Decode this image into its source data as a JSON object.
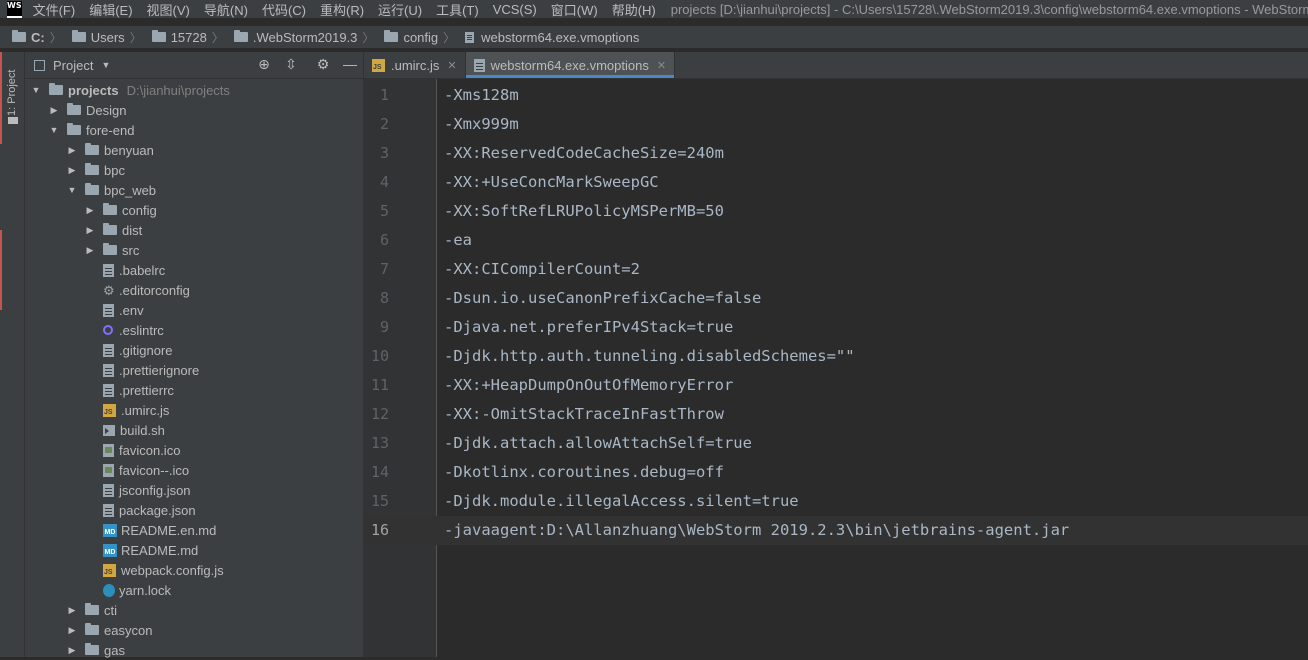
{
  "app": {
    "logo_text": "WS",
    "menus": [
      "文件(F)",
      "编辑(E)",
      "视图(V)",
      "导航(N)",
      "代码(C)",
      "重构(R)",
      "运行(U)",
      "工具(T)",
      "VCS(S)",
      "窗口(W)",
      "帮助(H)"
    ],
    "window_title": "projects [D:\\jianhui\\projects] - C:\\Users\\15728\\.WebStorm2019.3\\config\\webstorm64.exe.vmoptions - WebStorm"
  },
  "breadcrumb": [
    "C:",
    "Users",
    "15728",
    ".WebStorm2019.3",
    "config",
    "webstorm64.exe.vmoptions"
  ],
  "tool_stripe": {
    "label": "1: Project"
  },
  "project_panel": {
    "title": "Project"
  },
  "tree": [
    {
      "label": "projects",
      "path": "D:\\jianhui\\projects",
      "type": "folder",
      "arrow": "down",
      "depth": 0,
      "root": true
    },
    {
      "label": "Design",
      "type": "folder",
      "arrow": "right",
      "depth": 1
    },
    {
      "label": "fore-end",
      "type": "folder",
      "arrow": "down",
      "depth": 1
    },
    {
      "label": "benyuan",
      "type": "folder",
      "arrow": "right",
      "depth": 2
    },
    {
      "label": "bpc",
      "type": "folder",
      "arrow": "right",
      "depth": 2
    },
    {
      "label": "bpc_web",
      "type": "folder",
      "arrow": "down",
      "depth": 2
    },
    {
      "label": "config",
      "type": "folder",
      "arrow": "right",
      "depth": 3
    },
    {
      "label": "dist",
      "type": "folder",
      "arrow": "right",
      "depth": 3
    },
    {
      "label": "src",
      "type": "folder",
      "arrow": "right",
      "depth": 3
    },
    {
      "label": ".babelrc",
      "type": "generic",
      "depth": 3
    },
    {
      "label": ".editorconfig",
      "type": "gear",
      "depth": 3
    },
    {
      "label": ".env",
      "type": "generic",
      "depth": 3
    },
    {
      "label": ".eslintrc",
      "type": "ring",
      "depth": 3
    },
    {
      "label": ".gitignore",
      "type": "generic",
      "depth": 3
    },
    {
      "label": ".prettierignore",
      "type": "generic",
      "depth": 3
    },
    {
      "label": ".prettierrc",
      "type": "generic",
      "depth": 3
    },
    {
      "label": ".umirc.js",
      "type": "js",
      "depth": 3
    },
    {
      "label": "build.sh",
      "type": "sh",
      "depth": 3
    },
    {
      "label": "favicon.ico",
      "type": "ico",
      "depth": 3
    },
    {
      "label": "favicon--.ico",
      "type": "ico",
      "depth": 3
    },
    {
      "label": "jsconfig.json",
      "type": "generic",
      "depth": 3
    },
    {
      "label": "package.json",
      "type": "generic",
      "depth": 3
    },
    {
      "label": "README.en.md",
      "type": "md",
      "depth": 3
    },
    {
      "label": "README.md",
      "type": "md",
      "depth": 3
    },
    {
      "label": "webpack.config.js",
      "type": "js",
      "depth": 3
    },
    {
      "label": "yarn.lock",
      "type": "yarn",
      "depth": 3
    },
    {
      "label": "cti",
      "type": "folder",
      "arrow": "right",
      "depth": 2
    },
    {
      "label": "easycon",
      "type": "folder",
      "arrow": "right",
      "depth": 2
    },
    {
      "label": "gas",
      "type": "folder",
      "arrow": "right",
      "depth": 2
    }
  ],
  "tabs": [
    {
      "label": ".umirc.js",
      "type": "js",
      "active": false
    },
    {
      "label": "webstorm64.exe.vmoptions",
      "type": "generic",
      "active": true
    }
  ],
  "editor": {
    "current_line": 16,
    "lines": [
      "-Xms128m",
      "-Xmx999m",
      "-XX:ReservedCodeCacheSize=240m",
      "-XX:+UseConcMarkSweepGC",
      "-XX:SoftRefLRUPolicyMSPerMB=50",
      "-ea",
      "-XX:CICompilerCount=2",
      "-Dsun.io.useCanonPrefixCache=false",
      "-Djava.net.preferIPv4Stack=true",
      "-Djdk.http.auth.tunneling.disabledSchemes=\"\"",
      "-XX:+HeapDumpOnOutOfMemoryError",
      "-XX:-OmitStackTraceInFastThrow",
      "-Djdk.attach.allowAttachSelf=true",
      "-Dkotlinx.coroutines.debug=off",
      "-Djdk.module.illegalAccess.silent=true",
      "-javaagent:D:\\Allanzhuang\\WebStorm 2019.2.3\\bin\\jetbrains-agent.jar"
    ]
  }
}
